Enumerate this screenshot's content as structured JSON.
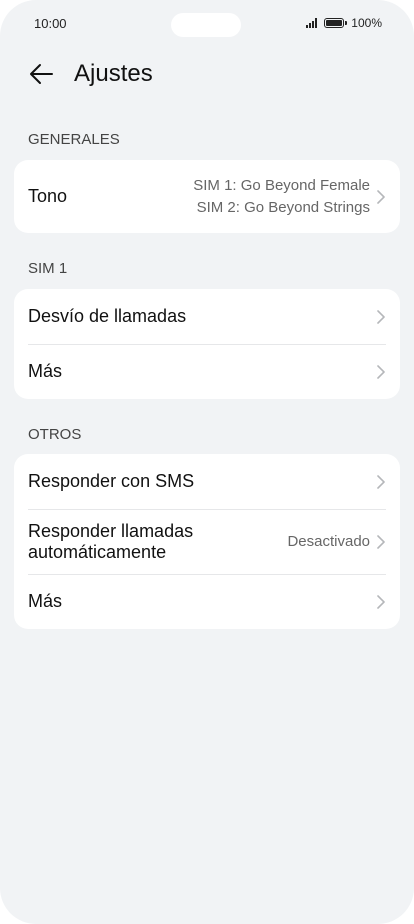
{
  "status_bar": {
    "time": "10:00",
    "battery": "100%"
  },
  "header": {
    "title": "Ajustes"
  },
  "sections": {
    "general": {
      "label": "GENERALES",
      "tone": {
        "label": "Tono",
        "value_line1": "SIM 1: Go Beyond Female",
        "value_line2": "SIM 2: Go Beyond Strings"
      }
    },
    "sim1": {
      "label": "SIM 1",
      "call_forwarding": "Desvío de llamadas",
      "more": "Más"
    },
    "others": {
      "label": "OTROS",
      "reply_sms": "Responder con SMS",
      "auto_answer_line1": "Responder llamadas",
      "auto_answer_line2": "automáticamente",
      "auto_answer_value": "Desactivado",
      "more": "Más"
    }
  },
  "colors": {
    "background": "#f1f3f5",
    "card": "#ffffff",
    "chevron": "#b5b7ba"
  }
}
